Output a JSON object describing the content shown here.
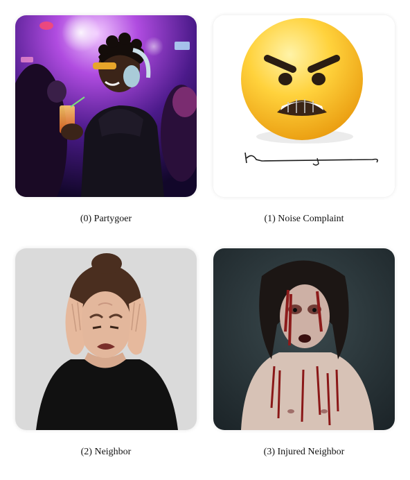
{
  "items": [
    {
      "caption": "(0) Partygoer",
      "icon": "partygoer-photo"
    },
    {
      "caption": "(1) Noise Complaint",
      "icon": "angry-emoji-signature-icon"
    },
    {
      "caption": "(2) Neighbor",
      "icon": "stressed-neighbor-photo"
    },
    {
      "caption": "(3) Injured Neighbor",
      "icon": "injured-neighbor-photo"
    }
  ]
}
